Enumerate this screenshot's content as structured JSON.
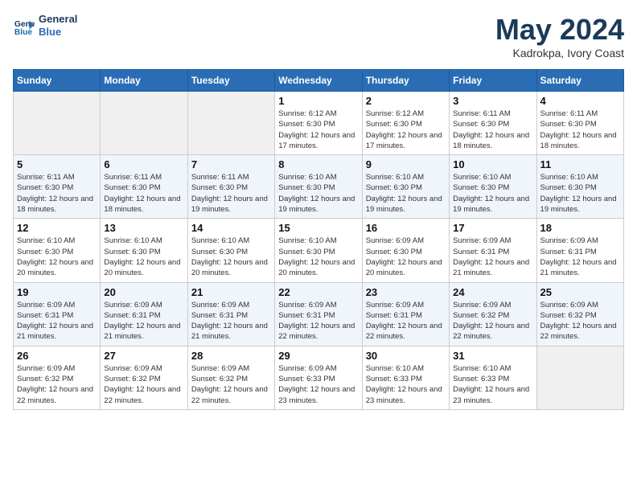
{
  "header": {
    "logo_line1": "General",
    "logo_line2": "Blue",
    "month": "May 2024",
    "location": "Kadrokpa, Ivory Coast"
  },
  "weekdays": [
    "Sunday",
    "Monday",
    "Tuesday",
    "Wednesday",
    "Thursday",
    "Friday",
    "Saturday"
  ],
  "weeks": [
    [
      {
        "day": "",
        "sunrise": "",
        "sunset": "",
        "daylight": "",
        "empty": true
      },
      {
        "day": "",
        "sunrise": "",
        "sunset": "",
        "daylight": "",
        "empty": true
      },
      {
        "day": "",
        "sunrise": "",
        "sunset": "",
        "daylight": "",
        "empty": true
      },
      {
        "day": "1",
        "sunrise": "Sunrise: 6:12 AM",
        "sunset": "Sunset: 6:30 PM",
        "daylight": "Daylight: 12 hours and 17 minutes."
      },
      {
        "day": "2",
        "sunrise": "Sunrise: 6:12 AM",
        "sunset": "Sunset: 6:30 PM",
        "daylight": "Daylight: 12 hours and 17 minutes."
      },
      {
        "day": "3",
        "sunrise": "Sunrise: 6:11 AM",
        "sunset": "Sunset: 6:30 PM",
        "daylight": "Daylight: 12 hours and 18 minutes."
      },
      {
        "day": "4",
        "sunrise": "Sunrise: 6:11 AM",
        "sunset": "Sunset: 6:30 PM",
        "daylight": "Daylight: 12 hours and 18 minutes."
      }
    ],
    [
      {
        "day": "5",
        "sunrise": "Sunrise: 6:11 AM",
        "sunset": "Sunset: 6:30 PM",
        "daylight": "Daylight: 12 hours and 18 minutes."
      },
      {
        "day": "6",
        "sunrise": "Sunrise: 6:11 AM",
        "sunset": "Sunset: 6:30 PM",
        "daylight": "Daylight: 12 hours and 18 minutes."
      },
      {
        "day": "7",
        "sunrise": "Sunrise: 6:11 AM",
        "sunset": "Sunset: 6:30 PM",
        "daylight": "Daylight: 12 hours and 19 minutes."
      },
      {
        "day": "8",
        "sunrise": "Sunrise: 6:10 AM",
        "sunset": "Sunset: 6:30 PM",
        "daylight": "Daylight: 12 hours and 19 minutes."
      },
      {
        "day": "9",
        "sunrise": "Sunrise: 6:10 AM",
        "sunset": "Sunset: 6:30 PM",
        "daylight": "Daylight: 12 hours and 19 minutes."
      },
      {
        "day": "10",
        "sunrise": "Sunrise: 6:10 AM",
        "sunset": "Sunset: 6:30 PM",
        "daylight": "Daylight: 12 hours and 19 minutes."
      },
      {
        "day": "11",
        "sunrise": "Sunrise: 6:10 AM",
        "sunset": "Sunset: 6:30 PM",
        "daylight": "Daylight: 12 hours and 19 minutes."
      }
    ],
    [
      {
        "day": "12",
        "sunrise": "Sunrise: 6:10 AM",
        "sunset": "Sunset: 6:30 PM",
        "daylight": "Daylight: 12 hours and 20 minutes."
      },
      {
        "day": "13",
        "sunrise": "Sunrise: 6:10 AM",
        "sunset": "Sunset: 6:30 PM",
        "daylight": "Daylight: 12 hours and 20 minutes."
      },
      {
        "day": "14",
        "sunrise": "Sunrise: 6:10 AM",
        "sunset": "Sunset: 6:30 PM",
        "daylight": "Daylight: 12 hours and 20 minutes."
      },
      {
        "day": "15",
        "sunrise": "Sunrise: 6:10 AM",
        "sunset": "Sunset: 6:30 PM",
        "daylight": "Daylight: 12 hours and 20 minutes."
      },
      {
        "day": "16",
        "sunrise": "Sunrise: 6:09 AM",
        "sunset": "Sunset: 6:30 PM",
        "daylight": "Daylight: 12 hours and 20 minutes."
      },
      {
        "day": "17",
        "sunrise": "Sunrise: 6:09 AM",
        "sunset": "Sunset: 6:31 PM",
        "daylight": "Daylight: 12 hours and 21 minutes."
      },
      {
        "day": "18",
        "sunrise": "Sunrise: 6:09 AM",
        "sunset": "Sunset: 6:31 PM",
        "daylight": "Daylight: 12 hours and 21 minutes."
      }
    ],
    [
      {
        "day": "19",
        "sunrise": "Sunrise: 6:09 AM",
        "sunset": "Sunset: 6:31 PM",
        "daylight": "Daylight: 12 hours and 21 minutes."
      },
      {
        "day": "20",
        "sunrise": "Sunrise: 6:09 AM",
        "sunset": "Sunset: 6:31 PM",
        "daylight": "Daylight: 12 hours and 21 minutes."
      },
      {
        "day": "21",
        "sunrise": "Sunrise: 6:09 AM",
        "sunset": "Sunset: 6:31 PM",
        "daylight": "Daylight: 12 hours and 21 minutes."
      },
      {
        "day": "22",
        "sunrise": "Sunrise: 6:09 AM",
        "sunset": "Sunset: 6:31 PM",
        "daylight": "Daylight: 12 hours and 22 minutes."
      },
      {
        "day": "23",
        "sunrise": "Sunrise: 6:09 AM",
        "sunset": "Sunset: 6:31 PM",
        "daylight": "Daylight: 12 hours and 22 minutes."
      },
      {
        "day": "24",
        "sunrise": "Sunrise: 6:09 AM",
        "sunset": "Sunset: 6:32 PM",
        "daylight": "Daylight: 12 hours and 22 minutes."
      },
      {
        "day": "25",
        "sunrise": "Sunrise: 6:09 AM",
        "sunset": "Sunset: 6:32 PM",
        "daylight": "Daylight: 12 hours and 22 minutes."
      }
    ],
    [
      {
        "day": "26",
        "sunrise": "Sunrise: 6:09 AM",
        "sunset": "Sunset: 6:32 PM",
        "daylight": "Daylight: 12 hours and 22 minutes."
      },
      {
        "day": "27",
        "sunrise": "Sunrise: 6:09 AM",
        "sunset": "Sunset: 6:32 PM",
        "daylight": "Daylight: 12 hours and 22 minutes."
      },
      {
        "day": "28",
        "sunrise": "Sunrise: 6:09 AM",
        "sunset": "Sunset: 6:32 PM",
        "daylight": "Daylight: 12 hours and 22 minutes."
      },
      {
        "day": "29",
        "sunrise": "Sunrise: 6:09 AM",
        "sunset": "Sunset: 6:33 PM",
        "daylight": "Daylight: 12 hours and 23 minutes."
      },
      {
        "day": "30",
        "sunrise": "Sunrise: 6:10 AM",
        "sunset": "Sunset: 6:33 PM",
        "daylight": "Daylight: 12 hours and 23 minutes."
      },
      {
        "day": "31",
        "sunrise": "Sunrise: 6:10 AM",
        "sunset": "Sunset: 6:33 PM",
        "daylight": "Daylight: 12 hours and 23 minutes."
      },
      {
        "day": "",
        "sunrise": "",
        "sunset": "",
        "daylight": "",
        "empty": true
      }
    ]
  ]
}
